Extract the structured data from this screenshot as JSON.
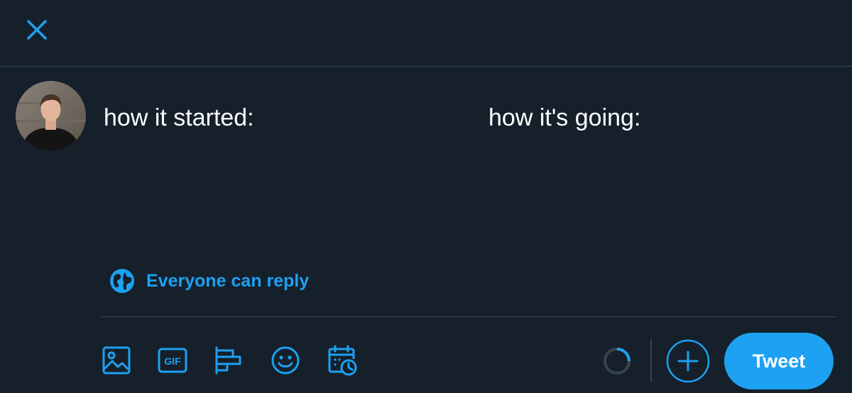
{
  "header": {
    "close_icon": "close-icon"
  },
  "composer": {
    "avatar_icon": "user-avatar",
    "text_part1": "how it started:",
    "text_part2": "how it's going:"
  },
  "reply_setting": {
    "icon": "globe-icon",
    "label": "Everyone can reply"
  },
  "toolbar": {
    "icons": [
      "image-icon",
      "gif-icon",
      "poll-icon",
      "emoji-icon",
      "schedule-icon"
    ],
    "gif_text": "GIF",
    "add_icon": "plus-icon",
    "tweet_label": "Tweet"
  },
  "colors": {
    "background": "#15202b",
    "accent": "#1da1f2",
    "border": "#38444d",
    "text": "#ffffff"
  }
}
